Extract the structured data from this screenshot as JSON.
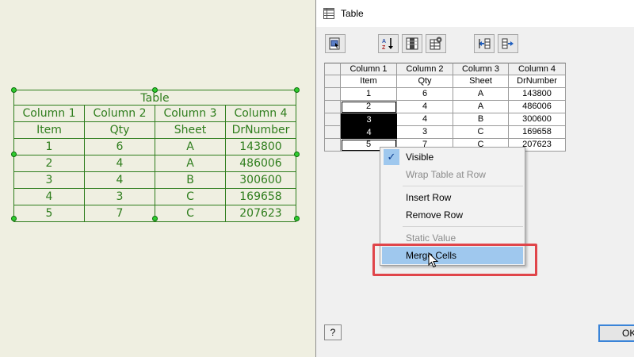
{
  "canvas_table": {
    "title": "Table",
    "headers": [
      "Column 1",
      "Column 2",
      "Column 3",
      "Column 4"
    ],
    "subheaders": [
      "Item",
      "Qty",
      "Sheet",
      "DrNumber"
    ],
    "rows": [
      [
        "1",
        "6",
        "A",
        "143800"
      ],
      [
        "2",
        "4",
        "A",
        "486006"
      ],
      [
        "3",
        "4",
        "B",
        "300600"
      ],
      [
        "4",
        "3",
        "C",
        "169658"
      ],
      [
        "5",
        "7",
        "C",
        "207623"
      ]
    ],
    "line_color": "#2e7d1c",
    "grip_color": "#2ecc2e"
  },
  "dialog": {
    "title": "Table",
    "toolbar": [
      {
        "icon": "table-properties-icon"
      },
      {
        "icon": "sort-az-icon"
      },
      {
        "icon": "column-chooser-icon"
      },
      {
        "icon": "table-settings-icon"
      },
      {
        "icon": "row-insert-left-icon"
      },
      {
        "icon": "row-export-right-icon"
      }
    ],
    "grid": {
      "headers": [
        "Column 1",
        "Column 2",
        "Column 3",
        "Column 4"
      ],
      "subheaders": [
        "Item",
        "Qty",
        "Sheet",
        "DrNumber"
      ],
      "rows": [
        [
          "1",
          "6",
          "A",
          "143800"
        ],
        [
          "2",
          "4",
          "A",
          "486006"
        ],
        [
          "3",
          "4",
          "B",
          "300600"
        ],
        [
          "4",
          "3",
          "C",
          "169658"
        ],
        [
          "5",
          "7",
          "C",
          "207623"
        ]
      ],
      "selected_rows": [
        "3",
        "4"
      ]
    },
    "ok_label": "OK",
    "help_label": "?"
  },
  "context_menu": {
    "visible": "Visible",
    "wrap": "Wrap Table at Row",
    "insert_row": "Insert Row",
    "remove_row": "Remove Row",
    "static_value": "Static Value",
    "merge_cells": "Merge Cells",
    "highlight_color": "#e0454a",
    "hover_color": "#9fc8ee"
  }
}
